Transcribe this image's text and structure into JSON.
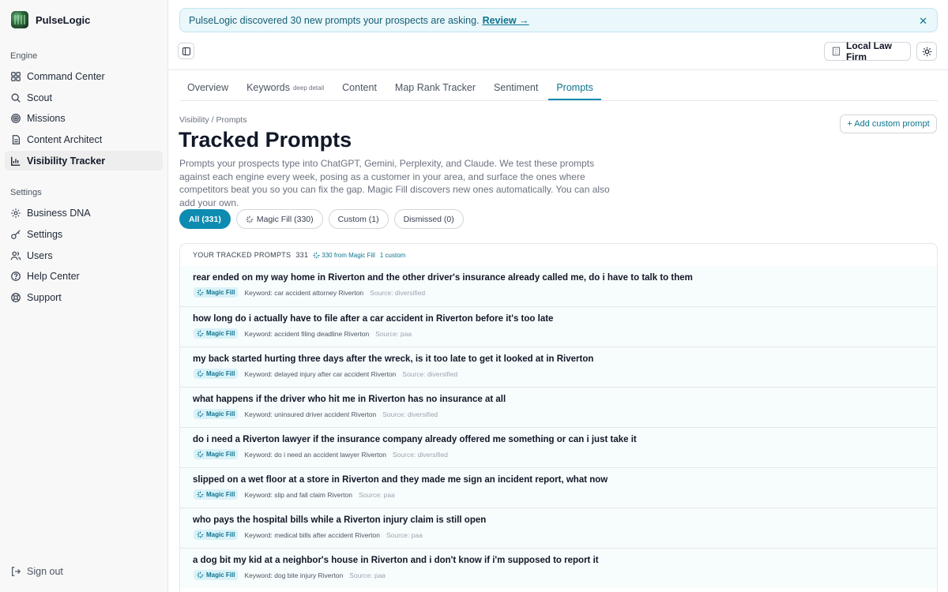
{
  "app": {
    "name": "PulseLogic"
  },
  "sidebar": {
    "engine_label": "Engine",
    "engine_items": [
      {
        "label": "Command Center",
        "icon": "grid-icon"
      },
      {
        "label": "Scout",
        "icon": "search-icon"
      },
      {
        "label": "Missions",
        "icon": "target-icon"
      },
      {
        "label": "Content Architect",
        "icon": "document-icon"
      },
      {
        "label": "Visibility Tracker",
        "icon": "bar-chart-icon",
        "active": true
      }
    ],
    "settings_label": "Settings",
    "settings_items": [
      {
        "label": "Business DNA",
        "icon": "gear-icon"
      },
      {
        "label": "Settings",
        "icon": "key-icon"
      },
      {
        "label": "Users",
        "icon": "users-icon"
      },
      {
        "label": "Help Center",
        "icon": "help-circle-icon"
      },
      {
        "label": "Support",
        "icon": "life-buoy-icon"
      }
    ],
    "sign_out": "Sign out"
  },
  "banner": {
    "text": "PulseLogic discovered 30 new prompts your prospects are asking.",
    "link": "Review →"
  },
  "header": {
    "firm": "Local Law Firm"
  },
  "tabs": [
    {
      "label": "Overview"
    },
    {
      "label": "Keywords",
      "sub": "deep detail"
    },
    {
      "label": "Content"
    },
    {
      "label": "Map Rank Tracker"
    },
    {
      "label": "Sentiment"
    },
    {
      "label": "Prompts",
      "active": true
    }
  ],
  "page": {
    "breadcrumb": "Visibility / Prompts",
    "title": "Tracked Prompts",
    "description": "Prompts your prospects type into ChatGPT, Gemini, Perplexity, and Claude. We test these prompts against each engine every week, posing as a customer in your area, and surface the ones where competitors beat you so you can fix the gap. Magic Fill discovers new ones automatically. You can also add your own.",
    "add_button": "+ Add custom prompt"
  },
  "filters": [
    {
      "label": "All (331)",
      "active": true
    },
    {
      "label": "Magic Fill (330)",
      "icon": true
    },
    {
      "label": "Custom (1)"
    },
    {
      "label": "Dismissed (0)"
    }
  ],
  "list": {
    "heading": "YOUR TRACKED PROMPTS",
    "count": "331",
    "magic_fill": "330 from Magic Fill",
    "custom": "1 custom",
    "badge_label": "Magic Fill",
    "rows": [
      {
        "q": "rear ended on my way home in Riverton and the other driver's insurance already called me, do i have to talk to them",
        "keyword": "Keyword: car accident attorney Riverton",
        "source": "Source: diversified"
      },
      {
        "q": "how long do i actually have to file after a car accident in Riverton before it's too late",
        "keyword": "Keyword: accident filing deadline Riverton",
        "source": "Source: paa"
      },
      {
        "q": "my back started hurting three days after the wreck, is it too late to get it looked at in Riverton",
        "keyword": "Keyword: delayed injury after car accident Riverton",
        "source": "Source: diversified"
      },
      {
        "q": "what happens if the driver who hit me in Riverton has no insurance at all",
        "keyword": "Keyword: uninsured driver accident Riverton",
        "source": "Source: diversified"
      },
      {
        "q": "do i need a Riverton lawyer if the insurance company already offered me something or can i just take it",
        "keyword": "Keyword: do i need an accident lawyer Riverton",
        "source": "Source: diversified"
      },
      {
        "q": "slipped on a wet floor at a store in Riverton and they made me sign an incident report, what now",
        "keyword": "Keyword: slip and fall claim Riverton",
        "source": "Source: paa"
      },
      {
        "q": "who pays the hospital bills while a Riverton injury claim is still open",
        "keyword": "Keyword: medical bills after accident Riverton",
        "source": "Source: paa"
      },
      {
        "q": "a dog bit my kid at a neighbor's house in Riverton and i don't know if i'm supposed to report it",
        "keyword": "Keyword: dog bite injury Riverton",
        "source": "Source: paa"
      }
    ]
  }
}
